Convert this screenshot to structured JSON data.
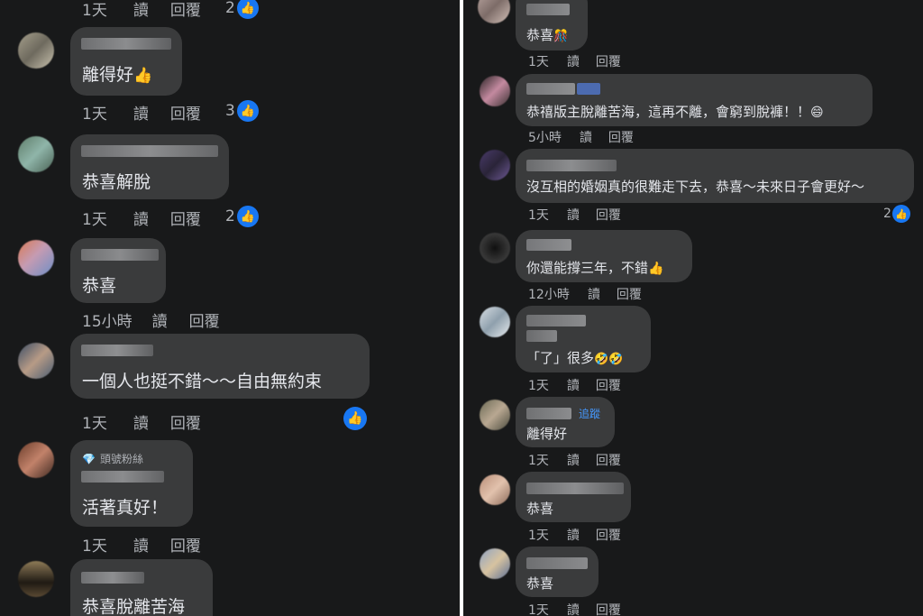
{
  "labels": {
    "read": "讀",
    "reply": "回覆",
    "follow": "追蹤"
  },
  "left": {
    "comments": [
      {
        "text": "",
        "time": "1天",
        "reactions": "2"
      },
      {
        "text": "離得好",
        "time": "1天",
        "reactions": "3"
      },
      {
        "text": "恭喜解脫",
        "time": "1天",
        "reactions": "2"
      },
      {
        "text": "恭喜",
        "time": "15小時",
        "reactions": ""
      },
      {
        "text": "一個人也挺不錯～～自由無約束",
        "time": "1天",
        "reactions": ""
      },
      {
        "badge": "頭號粉絲",
        "text": "活著真好！",
        "time": "1天",
        "reactions": ""
      },
      {
        "text": "恭喜脫離苦海",
        "time": "",
        "reactions": ""
      }
    ]
  },
  "right": {
    "comments": [
      {
        "text": "恭喜",
        "time": "1天",
        "reactions": ""
      },
      {
        "text": "恭禧版主脫離苦海，這再不離，會窮到脫褲！！",
        "time": "5小時",
        "reactions": ""
      },
      {
        "text": "沒互相的婚姻真的很難走下去，恭喜～未來日子會更好～",
        "time": "1天",
        "reactions": "2"
      },
      {
        "text": "你還能撐三年，不錯",
        "time": "12小時",
        "reactions": ""
      },
      {
        "text": "「了」很多",
        "time": "1天",
        "reactions": ""
      },
      {
        "text": "離得好",
        "time": "1天",
        "reactions": ""
      },
      {
        "text": "恭喜",
        "time": "1天",
        "reactions": ""
      },
      {
        "text": "恭喜",
        "time": "1天",
        "reactions": ""
      }
    ]
  },
  "icons": {
    "like": "thumbs-up-icon",
    "badge": "diamond-icon",
    "thumb_emoji": "👍",
    "laugh_emoji": "🤣",
    "smile_emoji": "😄",
    "party_emoji": "🎊"
  },
  "colors": {
    "panel_bg": "#18191a",
    "bubble_bg": "#3a3b3c",
    "text": "#e4e6eb",
    "meta": "#b0b3b8",
    "like_blue": "#1877f2",
    "follow_blue": "#4599ff"
  }
}
